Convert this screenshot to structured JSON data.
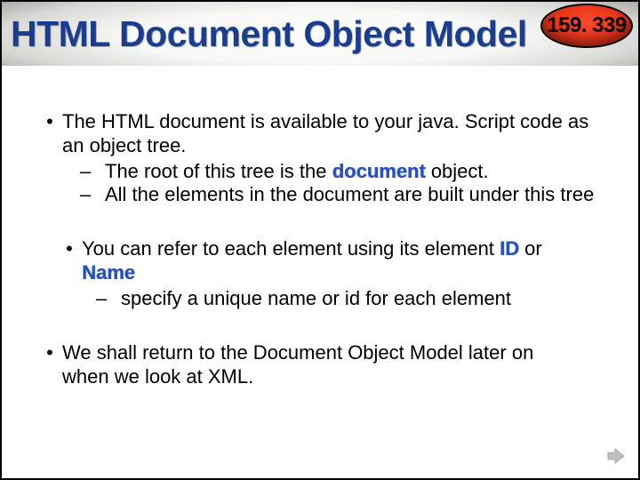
{
  "title": "HTML Document Object Model",
  "badge": "159. 339",
  "b1": {
    "line1_a": "The HTML document is available to your java. Script code as",
    "line1_b": "an object tree.",
    "sub1_a": "The root of this tree is the ",
    "sub1_kw": "document",
    "sub1_b": " object.",
    "sub2": "All the elements in the document are built under this tree"
  },
  "b2": {
    "line1_a": "You can refer to each element using its element ",
    "kw_id": "ID",
    "line1_b": " or",
    "kw_name": "Name",
    "sub1": "specify a unique name or id for each element"
  },
  "b3": {
    "line1": "We shall return to the Document Object Model later on",
    "line2": "when we look at XML."
  }
}
